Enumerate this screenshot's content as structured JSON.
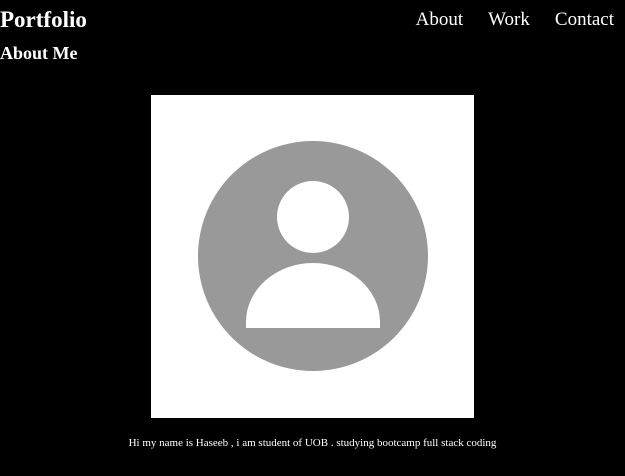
{
  "header": {
    "brand": "Portfolio",
    "nav": [
      {
        "label": "About"
      },
      {
        "label": "Work"
      },
      {
        "label": "Contact"
      }
    ]
  },
  "about": {
    "title": "About Me",
    "avatar_icon": "user-placeholder-icon",
    "bio": "Hi my name is Haseeb , i am student of UOB . studying bootcamp full stack coding"
  },
  "colors": {
    "background": "#000000",
    "text": "#ffffff",
    "avatar_frame": "#ffffff",
    "avatar_circle": "#999999"
  }
}
